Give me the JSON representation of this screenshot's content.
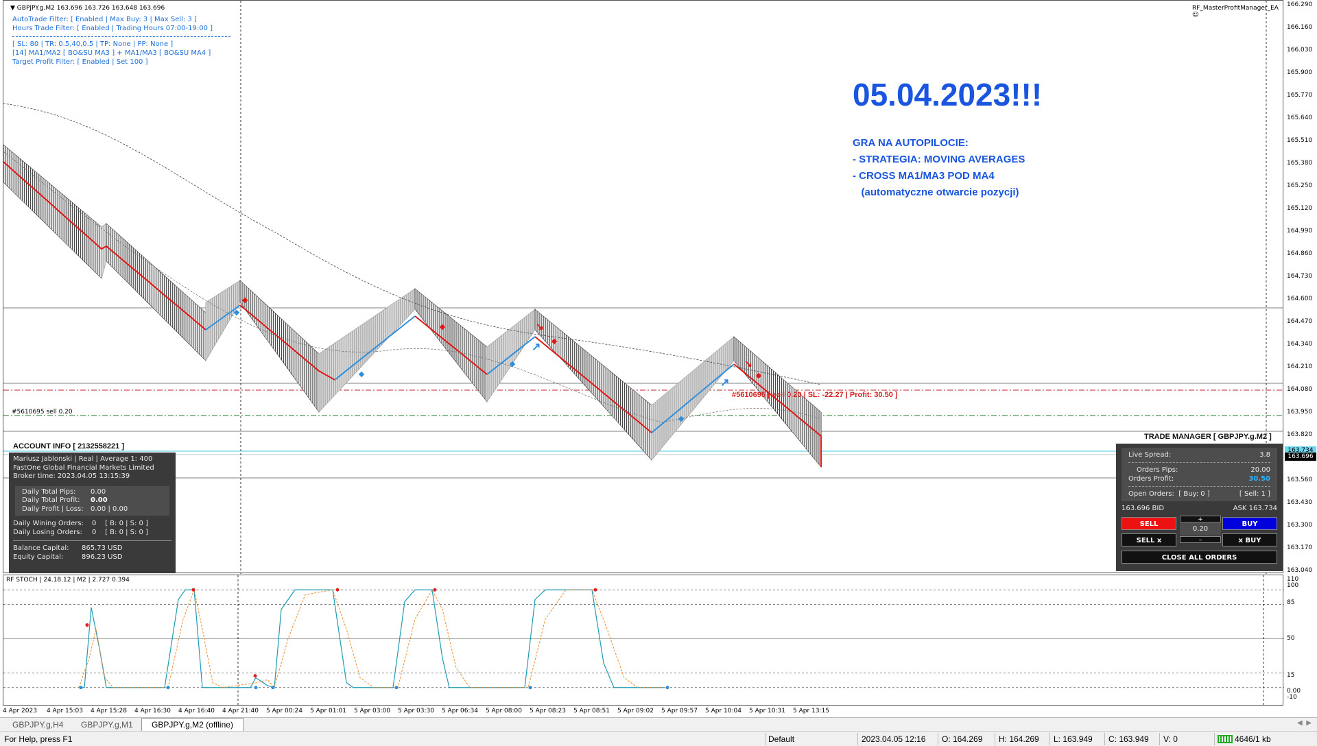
{
  "chart": {
    "symbol_line": "GBPJPY.g,M2  163.696 163.726 163.648 163.696",
    "ea_name": "RF_MasterProfitManager_EA",
    "filters": {
      "autotrade": "AutoTrade Filter: [ Enabled | Max Buy: 3 | Max Sell: 3 ]",
      "hours": "Hours Trade Filter: [ Enabled | Trading Hours 07:00-19:00 ]",
      "sl": "[ SL: 80 | TR: 0.5,40,0.5 | TP: None | PP: None ]",
      "ma": "[14] MA1/MA2 [ BO&SU MA3 ] + MA1/MA3 [ BO&SU MA4 ]",
      "target": "Target Profit Filter: [ Enabled | Set 100 ]"
    },
    "headline": "05.04.2023!!!",
    "subtext": [
      "GRA NA AUTOPILOCIE:",
      "- STRATEGIA: MOVING AVERAGES",
      "- CROSS MA1/MA3 POD MA4",
      "   (automatyczne otwarcie pozycji)"
    ],
    "order_label": "#5610695 sell 0.20",
    "position_label": "#5610695 [ sell 0.20 | SL: -22.27 | Profit: 30.50 ]",
    "price_axis": [
      "166.290",
      "166.160",
      "166.030",
      "165.900",
      "165.770",
      "165.640",
      "165.510",
      "165.380",
      "165.250",
      "165.120",
      "164.990",
      "164.860",
      "164.730",
      "164.600",
      "164.470",
      "164.340",
      "164.210",
      "164.080",
      "163.950",
      "163.820",
      "163.690",
      "163.560",
      "163.430",
      "163.300",
      "163.170",
      "163.040"
    ],
    "current_price_tag": "163.696",
    "ask_price_tag": "163.734",
    "colors": {
      "bull_ma": "#2b8fe0",
      "bear_ma": "#e01818",
      "headline": "#1a55e0"
    }
  },
  "account": {
    "title": "ACCOUNT INFO [ 2132558221 ]",
    "name_line": "Mariusz Jablonski | Real | Average 1: 400",
    "broker_line": "FastOne Global Financial Markets Limited",
    "time_line": "Broker time: 2023.04.05 13:15:39",
    "daily_pips_label": "Daily Total Pips:",
    "daily_pips_value": "0.00",
    "daily_profit_label": "Daily Total Profit:",
    "daily_profit_value": "0.00",
    "daily_pl_label": "Daily Profit | Loss:",
    "daily_pl_value": "0.00 | 0.00",
    "winning_label": "Daily Wining Orders:",
    "winning_value": "0    [ B: 0 | S: 0 ]",
    "losing_label": "Daily Losing Orders:",
    "losing_value": "0    [ B: 0 | S: 0 ]",
    "balance_label": "Balance Capital:",
    "balance_value": "865.73 USD",
    "equity_label": "Equity Capital:",
    "equity_value": "896.23 USD"
  },
  "trade_manager": {
    "title": "TRADE MANAGER [ GBPJPY.g.M2 ]",
    "spread_label": "Live Spread:",
    "spread_value": "3.8",
    "pips_label": "Orders Pips:",
    "pips_value": "20.00",
    "profit_label": "Orders Profit:",
    "profit_value": "30.50",
    "open_orders_label": "Open Orders:",
    "open_orders_buy": "[ Buy: 0 ]",
    "open_orders_sell": "[ Sell: 1 ]",
    "bid": "163.696 BID",
    "ask": "ASK 163.734",
    "sell_label": "SELL",
    "buy_label": "BUY",
    "lot_plus": "+",
    "lot_minus": "–",
    "lot_value": "0.20",
    "sell_x_label": "SELL x",
    "x_buy_label": "x BUY",
    "close_all_label": "CLOSE ALL ORDERS"
  },
  "stoch": {
    "title": "RF STOCH | 24.18.12 | M2 | 2.727 0.394",
    "axis": [
      "110",
      "100",
      "85",
      "50",
      "15",
      "0.00",
      "-10"
    ]
  },
  "time_axis": [
    "4 Apr 2023",
    "4 Apr 15:03",
    "4 Apr 15:28",
    "4 Apr 16:30",
    "4 Apr 16:40",
    "4 Apr 21:40",
    "5 Apr 00:24",
    "5 Apr 01:01",
    "5 Apr 03:00",
    "5 Apr 03:30",
    "5 Apr 06:34",
    "5 Apr 08:00",
    "5 Apr 08:23",
    "5 Apr 08:51",
    "5 Apr 09:02",
    "5 Apr 09:57",
    "5 Apr 10:04",
    "5 Apr 10:31",
    "5 Apr 13:15"
  ],
  "tabs": [
    "GBPJPY.g,H4",
    "GBPJPY.g,M1",
    "GBPJPY.g,M2 (offline)"
  ],
  "status": {
    "help": "For Help, press F1",
    "profile": "Default",
    "datetime": "2023.04.05 12:16",
    "open": "O: 164.269",
    "high": "H: 164.269",
    "low": "L: 163.949",
    "close": "C: 163.949",
    "volume": "V: 0",
    "traffic": "4646/1 kb"
  }
}
